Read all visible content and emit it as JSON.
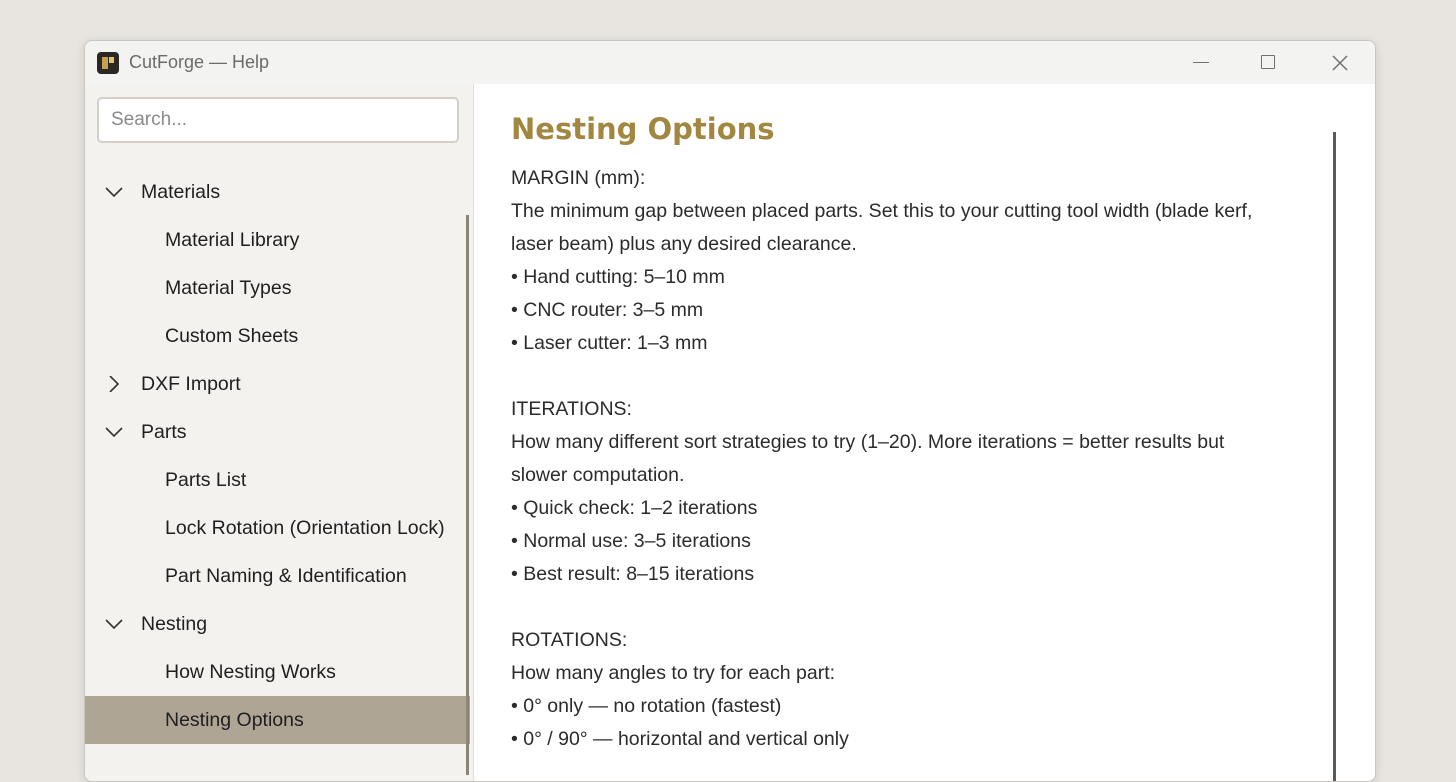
{
  "window": {
    "title": "CutForge — Help"
  },
  "search": {
    "placeholder": "Search..."
  },
  "sidebar": {
    "items": [
      {
        "label": "Materials",
        "level": 0,
        "expanded": true
      },
      {
        "label": "Material Library",
        "level": 1
      },
      {
        "label": "Material Types",
        "level": 1
      },
      {
        "label": "Custom Sheets",
        "level": 1
      },
      {
        "label": "DXF Import",
        "level": 0,
        "expanded": false
      },
      {
        "label": "Parts",
        "level": 0,
        "expanded": true
      },
      {
        "label": "Parts List",
        "level": 1
      },
      {
        "label": "Lock Rotation (Orientation Lock)",
        "level": 1
      },
      {
        "label": "Part Naming & Identification",
        "level": 1
      },
      {
        "label": "Nesting",
        "level": 0,
        "expanded": true
      },
      {
        "label": "How Nesting Works",
        "level": 1
      },
      {
        "label": "Nesting Options",
        "level": 1,
        "selected": true
      }
    ]
  },
  "content": {
    "heading": "Nesting Options",
    "lines": [
      "MARGIN (mm):",
      "The minimum gap between placed parts. Set this to your cutting tool width (blade kerf,",
      "laser beam) plus any desired clearance.",
      "• Hand cutting: 5–10 mm",
      "• CNC router: 3–5 mm",
      "• Laser cutter: 1–3 mm",
      "",
      "ITERATIONS:",
      "How many different sort strategies to try (1–20). More iterations = better results but",
      "slower computation.",
      "• Quick check: 1–2 iterations",
      "• Normal use: 3–5 iterations",
      "• Best result: 8–15 iterations",
      "",
      "ROTATIONS:",
      "How many angles to try for each part:",
      "• 0° only — no rotation (fastest)",
      "• 0° / 90° — horizontal and vertical only"
    ]
  },
  "colors": {
    "accent": "#a1873f",
    "selected_bg": "#aea595"
  }
}
